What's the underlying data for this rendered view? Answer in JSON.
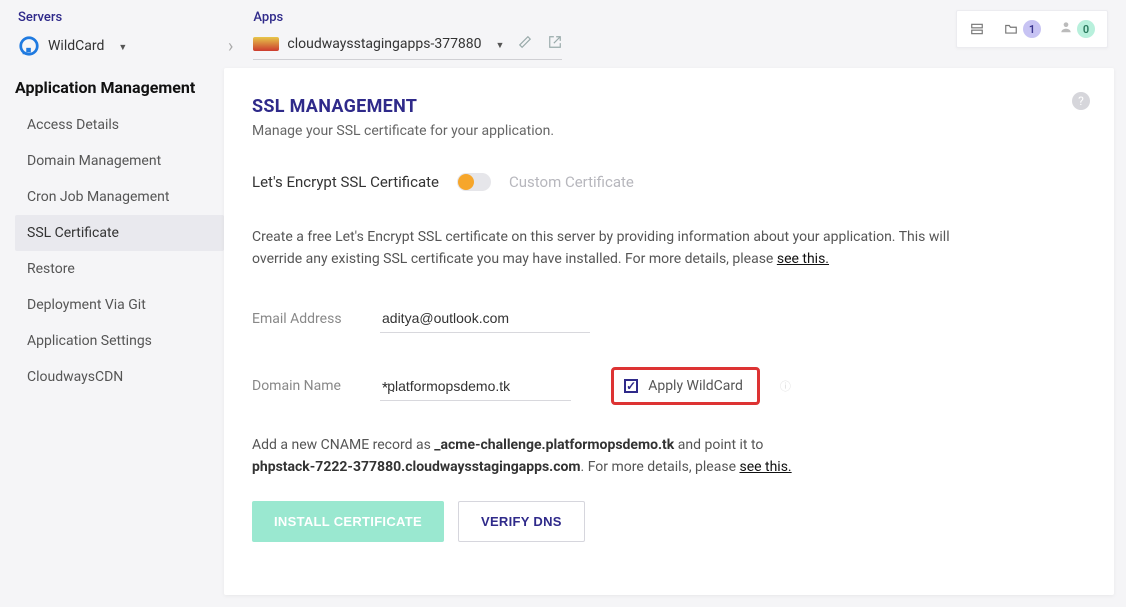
{
  "breadcrumb": {
    "servers_label": "Servers",
    "server_name": "WildCard",
    "apps_label": "Apps",
    "app_name": "cloudwaysstagingapps-377880"
  },
  "topbar": {
    "projects_badge": "1",
    "user_badge": "0"
  },
  "sidebar": {
    "heading": "Application Management",
    "items": [
      "Access Details",
      "Domain Management",
      "Cron Job Management",
      "SSL Certificate",
      "Restore",
      "Deployment Via Git",
      "Application Settings",
      "CloudwaysCDN"
    ],
    "active_index": 3
  },
  "panel": {
    "title": "SSL MANAGEMENT",
    "subtitle": "Manage your SSL certificate for your application."
  },
  "cert_tabs": {
    "lets_encrypt": "Let's Encrypt SSL Certificate",
    "custom": "Custom Certificate"
  },
  "description": {
    "text": "Create a free Let's Encrypt SSL certificate on this server by providing information about your application. This will override any existing SSL certificate you may have installed. For more details, please ",
    "link": "see this."
  },
  "form": {
    "email_label": "Email Address",
    "email_value": "aditya@outlook.com",
    "domain_label": "Domain Name",
    "domain_prefix": "* .",
    "domain_value": "platformopsdemo.tk",
    "wildcard_label": "Apply WildCard",
    "wildcard_checked": true
  },
  "cname": {
    "pre": "Add a new CNAME record as ",
    "record": "_acme-challenge.platformopsdemo.tk",
    "mid": " and point it to ",
    "target": "phpstack-7222-377880.cloudwaysstagingapps.com",
    "post": ". For more details, please ",
    "link": "see this."
  },
  "buttons": {
    "install": "INSTALL CERTIFICATE",
    "verify": "VERIFY DNS"
  }
}
